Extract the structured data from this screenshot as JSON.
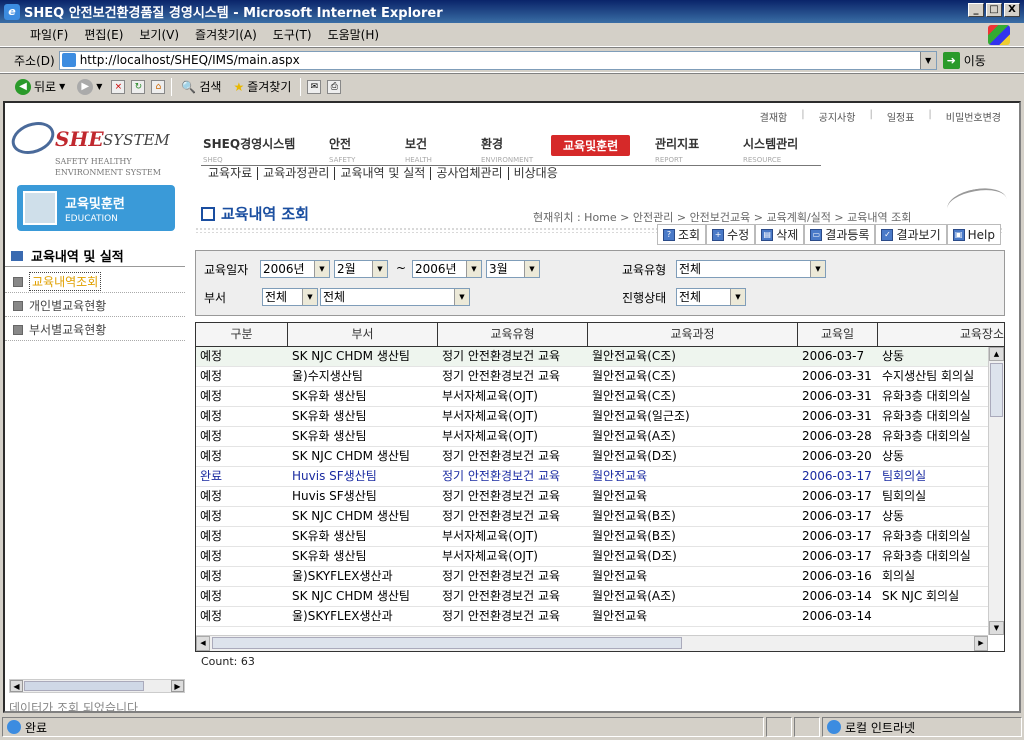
{
  "window": {
    "title": "SHEQ 안전보건환경품질 경영시스템 - Microsoft Internet Explorer",
    "buttons": [
      "_",
      "□",
      "X"
    ]
  },
  "menu": [
    "파일(F)",
    "편집(E)",
    "보기(V)",
    "즐겨찾기(A)",
    "도구(T)",
    "도움말(H)"
  ],
  "address": {
    "label": "주소(D)",
    "url": "http://localhost/SHEQ/IMS/main.aspx",
    "go": "이동"
  },
  "toolbar": {
    "back": "뒤로",
    "search": "검색",
    "favorites": "즐겨찾기"
  },
  "statusbar": {
    "text": "완료",
    "zone": "로컬 인트라넷"
  },
  "logo": {
    "brand": "SHE",
    "system": "SYSTEM",
    "tag1": "SAFETY HEALTHY",
    "tag2": "ENVIRONMENT SYSTEM"
  },
  "side": {
    "module_kr": "교육및훈련",
    "module_en": "EDUCATION",
    "header": "교육내역 및 실적",
    "items": [
      "교육내역조회",
      "개인별교육현황",
      "부서별교육현황"
    ],
    "status": "데이터가 조회 되었습니다"
  },
  "toplinks": [
    "결재함",
    "공지사항",
    "일정표",
    "비밀번호변경"
  ],
  "gnb": [
    {
      "kr": "SHEQ경영시스템",
      "en": "SHEQ"
    },
    {
      "kr": "안전",
      "en": "SAFETY"
    },
    {
      "kr": "보건",
      "en": "HEALTH"
    },
    {
      "kr": "환경",
      "en": "ENVIRONMENT"
    },
    {
      "kr": "교육및훈련",
      "en": ""
    },
    {
      "kr": "관리지표",
      "en": "REPORT"
    },
    {
      "kr": "시스템관리",
      "en": "RESOURCE"
    }
  ],
  "submenu": [
    "교육자료",
    "교육과정관리",
    "교육내역 및 실적",
    "공사업체관리",
    "비상대응"
  ],
  "page": {
    "title": "교육내역 조회",
    "breadcrumb": "현재위치 : Home > 안전관리 > 안전보건교육 > 교육계획/실적 > 교육내역 조회"
  },
  "buttons": [
    "조회",
    "수정",
    "삭제",
    "결과등록",
    "결과보기",
    "Help"
  ],
  "filter": {
    "date_label": "교육일자",
    "from_year": "2006년",
    "from_month": "2월",
    "tilde": "~",
    "to_year": "2006년",
    "to_month": "3월",
    "dept_label": "부서",
    "dept1": "전체",
    "dept2": "전체",
    "type_label": "교육유형",
    "type": "전체",
    "progress_label": "진행상태",
    "progress": "전체"
  },
  "grid": {
    "columns": [
      "구분",
      "부서",
      "교육유형",
      "교육과정",
      "교육일",
      "교육장소"
    ],
    "rows": [
      [
        "예정",
        "SK NJC CHDM 생산팀",
        "정기 안전환경보건 교육",
        "월안전교육(C조)",
        "2006-03-7",
        "상동"
      ],
      [
        "예정",
        "울)수지생산팀",
        "정기 안전환경보건 교육",
        "월안전교육(C조)",
        "2006-03-31",
        "수지생산팀 회의실"
      ],
      [
        "예정",
        "SK유화 생산팀",
        "부서자체교육(OJT)",
        "월안전교육(C조)",
        "2006-03-31",
        "유화3층 대회의실"
      ],
      [
        "예정",
        "SK유화 생산팀",
        "부서자체교육(OJT)",
        "월안전교육(일근조)",
        "2006-03-31",
        "유화3층 대회의실"
      ],
      [
        "예정",
        "SK유화 생산팀",
        "부서자체교육(OJT)",
        "월안전교육(A조)",
        "2006-03-28",
        "유화3층 대회의실"
      ],
      [
        "예정",
        "SK NJC CHDM 생산팀",
        "정기 안전환경보건 교육",
        "월안전교육(D조)",
        "2006-03-20",
        "상동"
      ],
      [
        "완료",
        "Huvis SF생산팀",
        "정기 안전환경보건 교육",
        "월안전교육",
        "2006-03-17",
        "팀회의실"
      ],
      [
        "예정",
        "Huvis SF생산팀",
        "정기 안전환경보건 교육",
        "월안전교육",
        "2006-03-17",
        "팀회의실"
      ],
      [
        "예정",
        "SK NJC CHDM 생산팀",
        "정기 안전환경보건 교육",
        "월안전교육(B조)",
        "2006-03-17",
        "상동"
      ],
      [
        "예정",
        "SK유화 생산팀",
        "부서자체교육(OJT)",
        "월안전교육(B조)",
        "2006-03-17",
        "유화3층 대회의실"
      ],
      [
        "예정",
        "SK유화 생산팀",
        "부서자체교육(OJT)",
        "월안전교육(D조)",
        "2006-03-17",
        "유화3층 대회의실"
      ],
      [
        "예정",
        "울)SKYFLEX생산과",
        "정기 안전환경보건 교육",
        "월안전교육",
        "2006-03-16",
        "회의실"
      ],
      [
        "예정",
        "SK NJC CHDM 생산팀",
        "정기 안전환경보건 교육",
        "월안전교육(A조)",
        "2006-03-14",
        "SK NJC 회의실"
      ],
      [
        "예정",
        "울)SKYFLEX생산과",
        "정기 안전환경보건 교육",
        "월안전교육",
        "2006-03-14",
        ""
      ]
    ],
    "count": "Count: 63"
  }
}
